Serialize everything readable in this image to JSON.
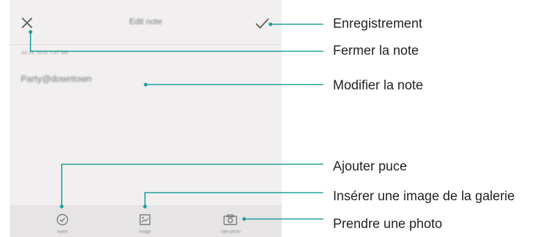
{
  "screen": {
    "title": "Edit note",
    "date": "Jul 29, 2016, 7:47 AM",
    "note_text": "Party@downtown",
    "toolbar": {
      "bullet_label": "Bullet",
      "image_label": "Image",
      "photo_label": "Take photo"
    }
  },
  "callouts": {
    "save": "Enregistrement",
    "close": "Fermer la note",
    "edit": "Modifier la note",
    "bullet": "Ajouter puce",
    "gallery": "Insérer une image de la galerie",
    "photo": "Prendre une photo"
  },
  "colors": {
    "callout_line": "#1a9e9a",
    "screen_bg": "#f1eff0",
    "toolbar_bg": "#e6e4e5"
  },
  "icons": [
    "close-icon",
    "check-icon",
    "bullet-icon",
    "image-icon",
    "camera-icon"
  ]
}
